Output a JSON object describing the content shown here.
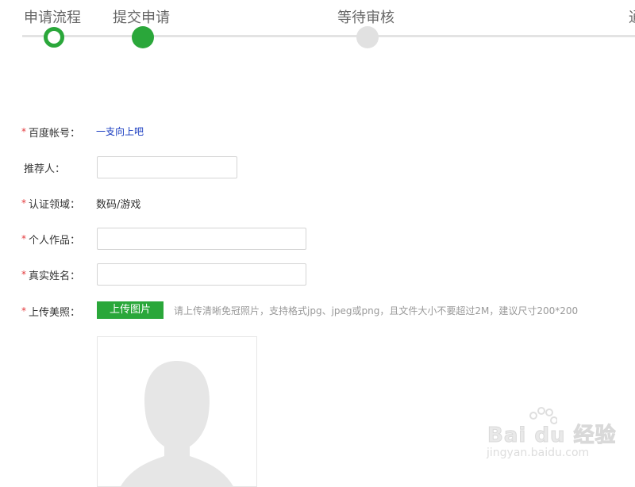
{
  "steps": [
    {
      "label": "申请流程",
      "state": "current"
    },
    {
      "label": "提交申请",
      "state": "done"
    },
    {
      "label": "等待审核",
      "state": "pending"
    },
    {
      "label": "通",
      "state": "pending"
    }
  ],
  "form": {
    "required_mark": "*",
    "baidu_account": {
      "label": "百度帐号：",
      "value": "一支向上吧"
    },
    "referrer": {
      "label": "推荐人：",
      "value": ""
    },
    "cert_field": {
      "label": "认证领域：",
      "value": "数码/游戏"
    },
    "works": {
      "label": "个人作品：",
      "value": ""
    },
    "real_name": {
      "label": "真实姓名：",
      "value": ""
    },
    "photo": {
      "label": "上传美照：",
      "button": "上传图片",
      "hint": "请上传清晰免冠照片，支持格式jpg、jpeg或png，且文件大小不要超过2M，建议尺寸200*200"
    }
  },
  "watermark": {
    "brand": "Bai du 经验",
    "url": "jingyan.baidu.com"
  },
  "colors": {
    "accent": "#2aa73a",
    "required": "#e3393c",
    "link": "#1a3dc1",
    "inactive": "#e1e1e1"
  }
}
